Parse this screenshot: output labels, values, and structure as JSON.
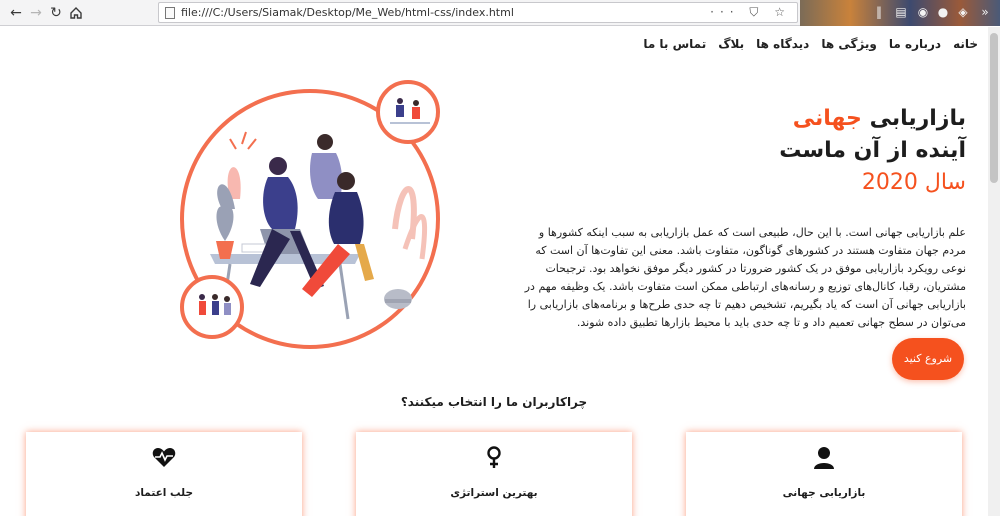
{
  "browser": {
    "url": "file:///C:/Users/Siamak/Desktop/Me_Web/html-css/index.html",
    "url_actions": "··· ⛉ ☆"
  },
  "nav": {
    "items": [
      {
        "label": "خانه"
      },
      {
        "label": "درباره ما"
      },
      {
        "label": "ویژگی ها"
      },
      {
        "label": "دیدگاه ها"
      },
      {
        "label": "بلاگ"
      },
      {
        "label": "تماس با ما"
      }
    ]
  },
  "hero": {
    "title_part1": "بازاریابی",
    "title_part2": "جهانی",
    "title_line2": "آینده از آن ماست",
    "title_line3": "سال 2020",
    "description": "علم بازاریابی جهانی است. با این حال، طبیعی است که عمل بازاریابی به سبب اینکه کشورها و مردم جهان متفاوت هستند در کشورهای گوناگون، متفاوت باشد. معنی این تفاوت‌ها آن است که نوعی رویکرد بازاریابی موفق در یک کشور ضرورتا در کشور دیگر موفق نخواهد بود. ترجیحات مشتریان، رقبا، کانال‌های توزیع و رسانه‌های ارتباطی ممکن است متفاوت باشد. یک وظیفه مهم در بازاریابی جهانی آن است که یاد بگیریم، تشخیص دهیم تا چه حدی طرح‌ها و برنامه‌های بازاریابی را می‌توان در سطح جهانی تعمیم داد و تا چه حدی باید با محیط بازارها تطبیق داده شوند.",
    "cta_label": "شروع کنید"
  },
  "features": {
    "title": "چراکاربران ما را انتخاب میکنند؟",
    "cards": [
      {
        "label": "بازاریابی جهانی",
        "icon": "user-icon"
      },
      {
        "label": "بهترین استراتژی",
        "icon": "female-symbol-icon"
      },
      {
        "label": "جلب اعتماد",
        "icon": "heartbeat-icon"
      }
    ]
  },
  "colors": {
    "accent": "#f5511e",
    "text": "#1d1d1d"
  }
}
